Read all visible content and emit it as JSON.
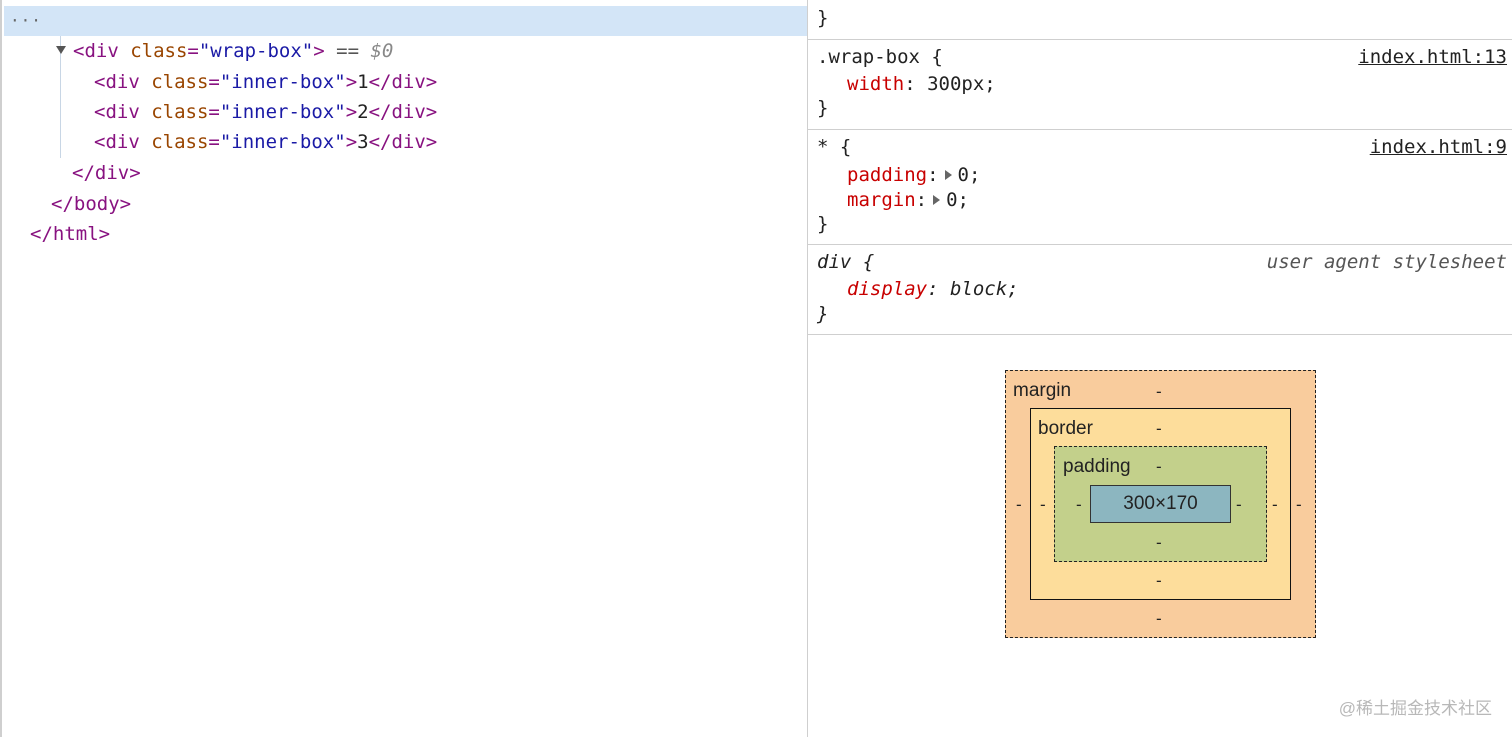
{
  "elements_panel": {
    "ellipsis": "···",
    "selected_line": {
      "open": "<div ",
      "attr": "class",
      "eq": "=",
      "value": "\"wrap-box\"",
      "close": ">",
      "equals_marker": " == ",
      "dollar_ref": "$0"
    },
    "children": [
      {
        "open": "<div ",
        "attr": "class",
        "eq": "=",
        "value": "\"inner-box\"",
        "close": ">",
        "text": "1",
        "end": "</div>"
      },
      {
        "open": "<div ",
        "attr": "class",
        "eq": "=",
        "value": "\"inner-box\"",
        "close": ">",
        "text": "2",
        "end": "</div>"
      },
      {
        "open": "<div ",
        "attr": "class",
        "eq": "=",
        "value": "\"inner-box\"",
        "close": ">",
        "text": "3",
        "end": "</div>"
      }
    ],
    "closing_div": "</div>",
    "closing_body": "</body>",
    "closing_html": "</html>"
  },
  "styles_panel": {
    "top_brace": "}",
    "rules": [
      {
        "selector": ".wrap-box {",
        "source": "index.html:13",
        "declarations": [
          {
            "prop": "width",
            "value": "300px;"
          }
        ],
        "end": "}"
      },
      {
        "selector": "* {",
        "source": "index.html:9",
        "declarations": [
          {
            "prop": "padding",
            "value": "0;"
          },
          {
            "prop": "margin",
            "value": "0;"
          }
        ],
        "end": "}"
      },
      {
        "selector": "div {",
        "source": "user agent stylesheet",
        "declarations": [
          {
            "prop": "display",
            "value": "block;"
          }
        ],
        "end": "}"
      }
    ]
  },
  "box_model": {
    "margin_label": "margin",
    "border_label": "border",
    "padding_label": "padding",
    "content_size": "300×170",
    "empty_value": "-",
    "colors": {
      "margin": "#f9cc9d",
      "border": "#fddd9b",
      "padding": "#c3d08b",
      "content": "#8cb6c0"
    }
  },
  "watermark": "@稀土掘金技术社区"
}
